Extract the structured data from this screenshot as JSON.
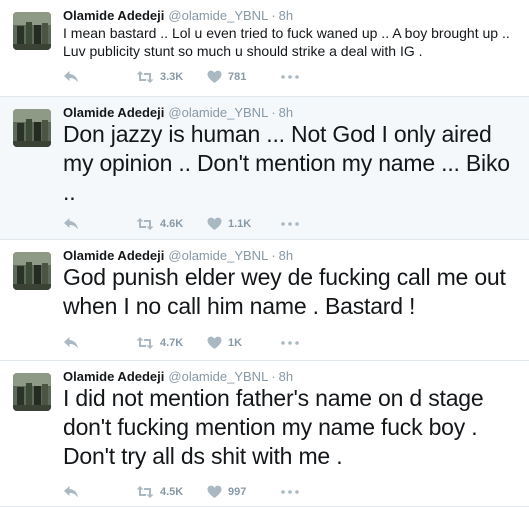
{
  "colors": {
    "name": "#14171a",
    "meta": "#8899a6",
    "icon": "#aab8c2",
    "tint_background": "#f5f8fa"
  },
  "tweets": [
    {
      "name": "Olamide Adedeji",
      "handle": "@olamide_YBNL",
      "time": "8h",
      "text": "I mean bastard .. Lol u even tried to fuck waned up .. A boy brought up .. Luv publicity stunt so much u should strike a deal with IG .",
      "retweets": "3.3K",
      "likes": "781"
    },
    {
      "name": "Olamide Adedeji",
      "handle": "@olamide_YBNL",
      "time": "8h",
      "text": "Don jazzy is human ... Not God I only aired my opinion .. Don't mention my name ... Biko ..",
      "retweets": "4.6K",
      "likes": "1.1K"
    },
    {
      "name": "Olamide Adedeji",
      "handle": "@olamide_YBNL",
      "time": "8h",
      "text": "God punish elder wey de fucking call me out when I no call him name . Bastard !",
      "retweets": "4.7K",
      "likes": "1K"
    },
    {
      "name": "Olamide Adedeji",
      "handle": "@olamide_YBNL",
      "time": "8h",
      "text": "I did not mention father's name on d stage don't fucking mention my name fuck boy . Don't try all ds shit with me .",
      "retweets": "4.5K",
      "likes": "997"
    }
  ]
}
